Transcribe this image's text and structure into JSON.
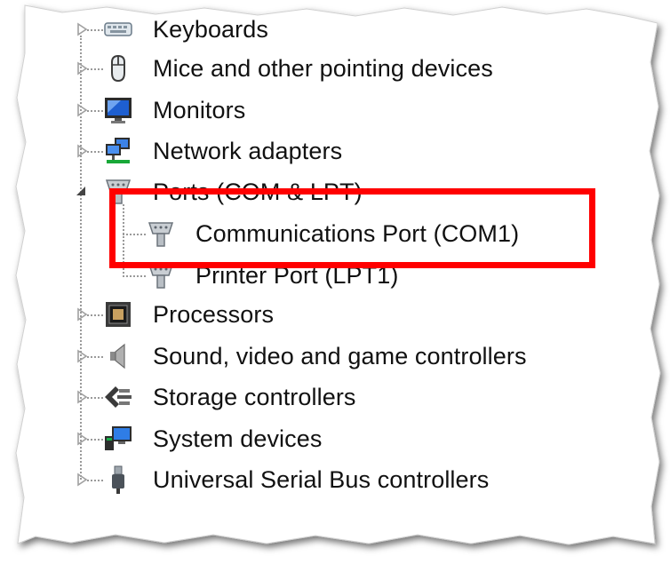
{
  "device_tree": {
    "items": [
      {
        "label": "Keyboards",
        "expanded": false,
        "icon": "keyboard-icon"
      },
      {
        "label": "Mice and other pointing devices",
        "expanded": false,
        "icon": "mouse-icon"
      },
      {
        "label": "Monitors",
        "expanded": false,
        "icon": "monitor-icon"
      },
      {
        "label": "Network adapters",
        "expanded": false,
        "icon": "network-adapter-icon"
      },
      {
        "label": "Ports (COM & LPT)",
        "expanded": true,
        "icon": "port-icon",
        "children": [
          {
            "label": "Communications Port (COM1)",
            "icon": "port-icon",
            "highlighted": true
          },
          {
            "label": "Printer Port (LPT1)",
            "icon": "port-icon"
          }
        ]
      },
      {
        "label": "Processors",
        "expanded": false,
        "icon": "processor-icon"
      },
      {
        "label": "Sound, video and game controllers",
        "expanded": false,
        "icon": "speaker-icon"
      },
      {
        "label": "Storage controllers",
        "expanded": false,
        "icon": "storage-controller-icon"
      },
      {
        "label": "System devices",
        "expanded": false,
        "icon": "system-devices-icon"
      },
      {
        "label": "Universal Serial Bus controllers",
        "expanded": false,
        "icon": "usb-plug-icon"
      }
    ]
  },
  "highlight": {
    "color": "#ff0000"
  },
  "colors": {
    "text": "#111111",
    "tree_lines": "#9a9a9a",
    "expander_arrow": "#a0a0a0"
  }
}
